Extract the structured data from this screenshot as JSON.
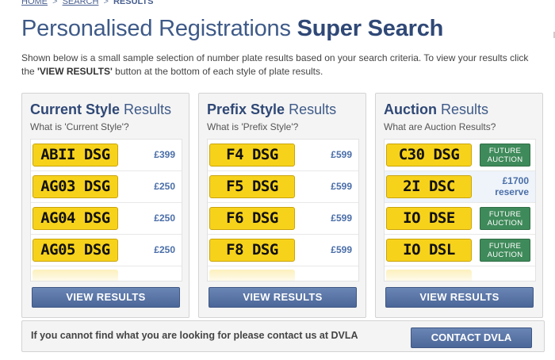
{
  "breadcrumb": {
    "home": "HOME",
    "search": "SEARCH",
    "current": "RESULTS",
    "sep": ">"
  },
  "title": {
    "light": "Personalised Registrations ",
    "bold": "Super Search"
  },
  "intro": {
    "part1": "Shown below is a small sample selection of number plate results based on your search criteria. To view your results click the ",
    "bold": "'VIEW RESULTS'",
    "part2": " button at the bottom of each style of plate results."
  },
  "panels": [
    {
      "title_bold": "Current Style",
      "title_light": " Results",
      "subtitle": "What is 'Current Style'?",
      "rows": [
        {
          "plate": "ABII DSG",
          "price": "£399"
        },
        {
          "plate": "AG03 DSG",
          "price": "£250"
        },
        {
          "plate": "AG04 DSG",
          "price": "£250"
        },
        {
          "plate": "AG05 DSG",
          "price": "£250"
        }
      ],
      "button": "VIEW RESULTS"
    },
    {
      "title_bold": "Prefix Style",
      "title_light": " Results",
      "subtitle": "What is 'Prefix Style'?",
      "rows": [
        {
          "plate": "F4 DSG",
          "price": "£599"
        },
        {
          "plate": "F5 DSG",
          "price": "£599"
        },
        {
          "plate": "F6 DSG",
          "price": "£599"
        },
        {
          "plate": "F8 DSG",
          "price": "£599"
        }
      ],
      "button": "VIEW RESULTS"
    },
    {
      "title_bold": "Auction",
      "title_light": " Results",
      "subtitle": "What are Auction Results?",
      "rows": [
        {
          "plate": "C30 DSG",
          "badge_line1": "FUTURE",
          "badge_line2": "AUCTION"
        },
        {
          "plate": "2I DSC",
          "price_line1": "£1700",
          "price_line2": "reserve"
        },
        {
          "plate": "IO DSE",
          "badge_line1": "FUTURE",
          "badge_line2": "AUCTION"
        },
        {
          "plate": "IO DSL",
          "badge_line1": "FUTURE",
          "badge_line2": "AUCTION"
        }
      ],
      "button": "VIEW RESULTS"
    }
  ],
  "footer": {
    "text": "If you cannot find what you are looking for please contact us at DVLA",
    "button": "CONTACT DVLA"
  }
}
